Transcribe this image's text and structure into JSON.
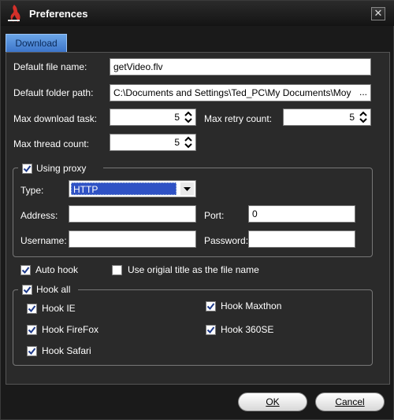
{
  "window": {
    "title": "Preferences",
    "close_label": "✕"
  },
  "tabs": [
    {
      "label": "Download"
    }
  ],
  "form": {
    "default_file_name": {
      "label": "Default file name:",
      "value": "getVideo.flv"
    },
    "default_folder_path": {
      "label": "Default folder path:",
      "value": "C:\\Documents and Settings\\Ted_PC\\My Documents\\Moy",
      "browse_label": "..."
    },
    "max_download_task": {
      "label": "Max download task:",
      "value": "5"
    },
    "max_retry_count": {
      "label": "Max retry count:",
      "value": "5"
    },
    "max_thread_count": {
      "label": "Max thread count:",
      "value": "5"
    }
  },
  "proxy": {
    "checkbox_label": "Using proxy",
    "checked": true,
    "type": {
      "label": "Type:",
      "value": "HTTP"
    },
    "address": {
      "label": "Address:",
      "value": ""
    },
    "port": {
      "label": "Port:",
      "value": "0"
    },
    "username": {
      "label": "Username:",
      "value": ""
    },
    "password": {
      "label": "Password:",
      "value": ""
    }
  },
  "options": {
    "auto_hook": {
      "label": "Auto hook",
      "checked": true
    },
    "use_title": {
      "label": "Use origial title as the file name",
      "checked": false
    }
  },
  "hook": {
    "hook_all": {
      "label": "Hook all",
      "checked": true
    },
    "items": [
      {
        "label": "Hook IE",
        "checked": true
      },
      {
        "label": "Hook Maxthon",
        "checked": true
      },
      {
        "label": "Hook FireFox",
        "checked": true
      },
      {
        "label": "Hook 360SE",
        "checked": true
      },
      {
        "label": "Hook Safari",
        "checked": true
      }
    ]
  },
  "buttons": {
    "ok": {
      "label": "OK"
    },
    "cancel": {
      "label": "Cancel"
    }
  },
  "colors": {
    "accent": "#3b73c8",
    "selection": "#2f52c5"
  }
}
